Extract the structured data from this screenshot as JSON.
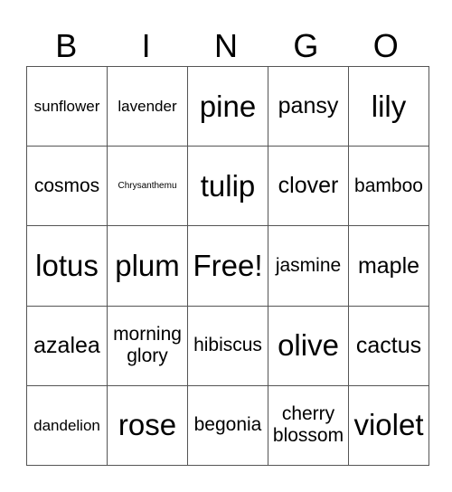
{
  "header": [
    "B",
    "I",
    "N",
    "G",
    "O"
  ],
  "cells": [
    [
      "sunflower",
      "lavender",
      "pine",
      "pansy",
      "lily"
    ],
    [
      "cosmos",
      "Chrysanthemu",
      "tulip",
      "clover",
      "bamboo"
    ],
    [
      "lotus",
      "plum",
      "Free!",
      "jasmine",
      "maple"
    ],
    [
      "azalea",
      "morning glory",
      "hibiscus",
      "olive",
      "cactus"
    ],
    [
      "dandelion",
      "rose",
      "begonia",
      "cherry blossom",
      "violet"
    ]
  ]
}
